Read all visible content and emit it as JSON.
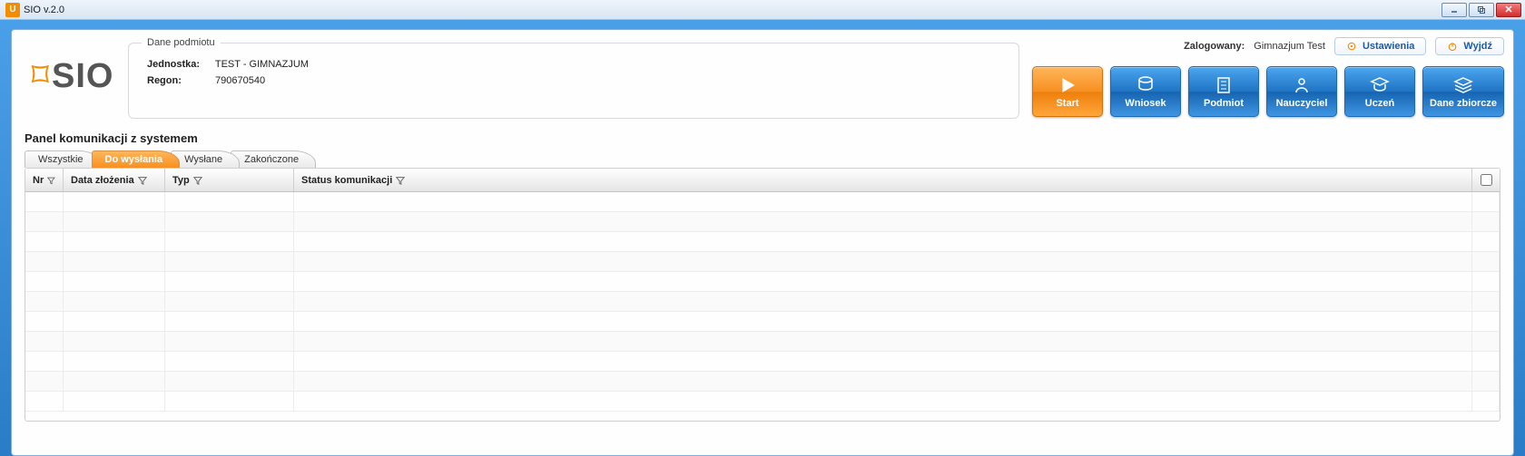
{
  "window": {
    "title": "SIO v.2.0"
  },
  "logo": {
    "text": "SIO"
  },
  "entity": {
    "legend": "Dane podmiotu",
    "jednostka_lbl": "Jednostka:",
    "jednostka_val": "TEST - GIMNAZJUM",
    "regon_lbl": "Regon:",
    "regon_val": "790670540"
  },
  "login": {
    "label": "Zalogowany:",
    "user": "Gimnazjum Test",
    "settings": "Ustawienia",
    "logout": "Wyjdź"
  },
  "nav": {
    "start": "Start",
    "wniosek": "Wniosek",
    "podmiot": "Podmiot",
    "nauczyciel": "Nauczyciel",
    "uczen": "Uczeń",
    "dane": "Dane zbiorcze"
  },
  "panel": {
    "title": "Panel komunikacji z systemem"
  },
  "tabs": {
    "all": "Wszystkie",
    "tosend": "Do wysłania",
    "sent": "Wysłane",
    "done": "Zakończone"
  },
  "columns": {
    "nr": "Nr",
    "date": "Data złożenia",
    "type": "Typ",
    "status": "Status komunikacji"
  }
}
